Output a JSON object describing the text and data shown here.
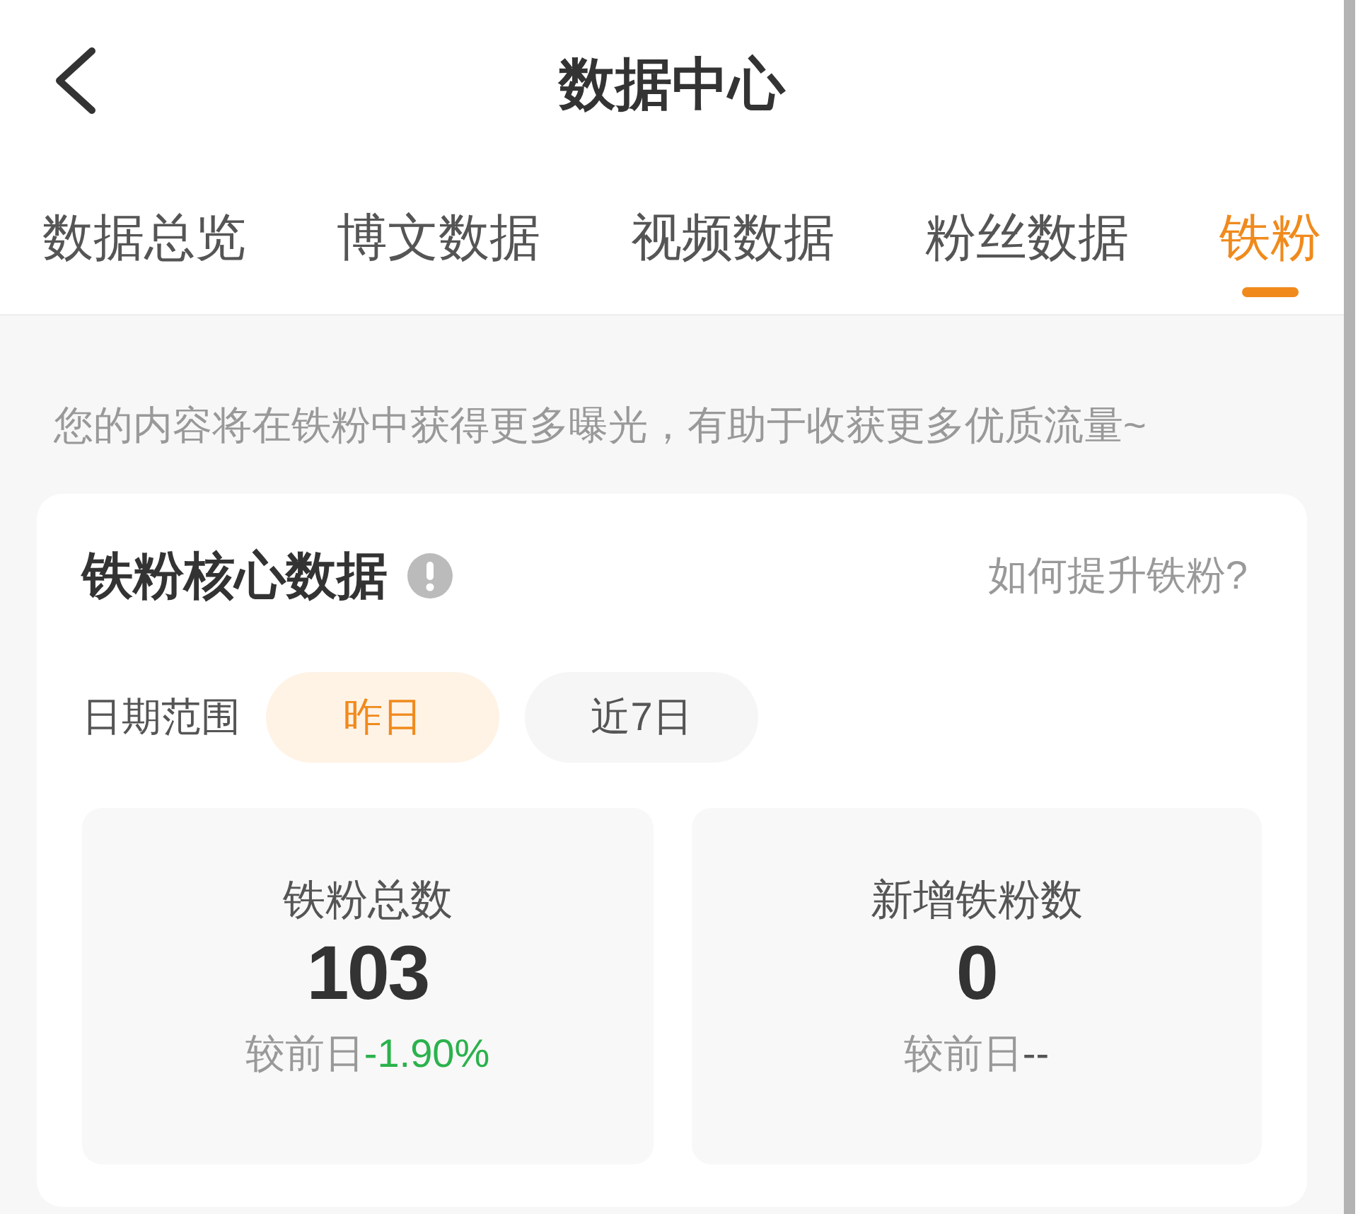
{
  "header": {
    "title": "数据中心"
  },
  "tabs": [
    {
      "label": "数据总览",
      "selected": false
    },
    {
      "label": "博文数据",
      "selected": false
    },
    {
      "label": "视频数据",
      "selected": false
    },
    {
      "label": "粉丝数据",
      "selected": false
    },
    {
      "label": "铁粉",
      "selected": true
    }
  ],
  "notice": "您的内容将在铁粉中获得更多曝光，有助于收获更多优质流量~",
  "core_card": {
    "title": "铁粉核心数据",
    "help_link": "如何提升铁粉?",
    "date_range": {
      "label": "日期范围",
      "options": [
        {
          "label": "昨日",
          "selected": true
        },
        {
          "label": "近7日",
          "selected": false
        }
      ]
    },
    "stats": [
      {
        "label": "铁粉总数",
        "value": "103",
        "compare_label": "较前日",
        "change": "-1.90%",
        "color": "#2bb24c"
      },
      {
        "label": "新增铁粉数",
        "value": "0",
        "compare_label": "较前日",
        "change": "--",
        "color": "#555555"
      }
    ]
  }
}
